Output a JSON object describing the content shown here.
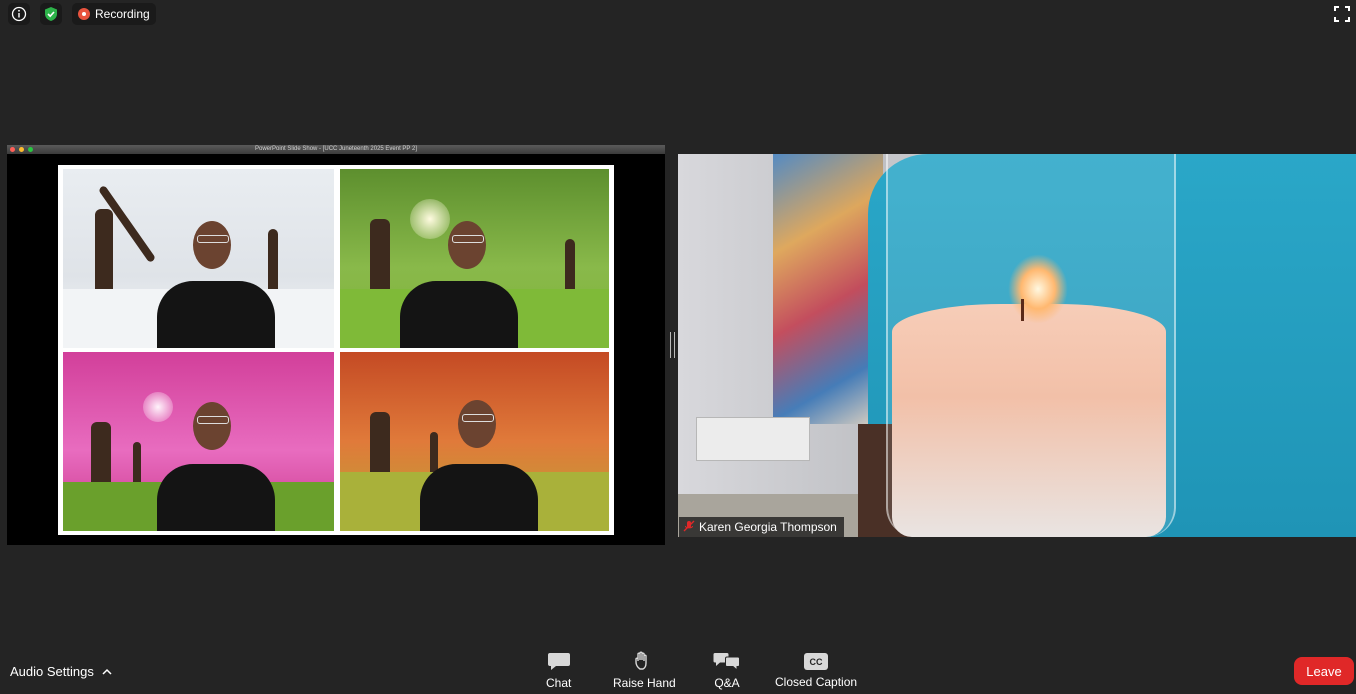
{
  "topbar": {
    "info_icon": "info-icon",
    "shield_icon": "shield-check-icon",
    "recording_label": "Recording",
    "fullscreen_icon": "fullscreen-icon"
  },
  "share": {
    "window_title": "PowerPoint Slide Show - [UCC Juneteenth 2025 Event PP 2]"
  },
  "video": {
    "participant_name": "Karen Georgia Thompson",
    "mic_muted_icon": "mic-muted-icon"
  },
  "toolbar": {
    "audio_settings_label": "Audio Settings",
    "chat_label": "Chat",
    "raise_hand_label": "Raise Hand",
    "qa_label": "Q&A",
    "cc_icon_text": "CC",
    "closed_caption_label": "Closed Caption",
    "leave_label": "Leave"
  },
  "colors": {
    "background": "#242424",
    "leave": "#e02828",
    "recording": "#e8533e",
    "shield": "#2db34a"
  }
}
